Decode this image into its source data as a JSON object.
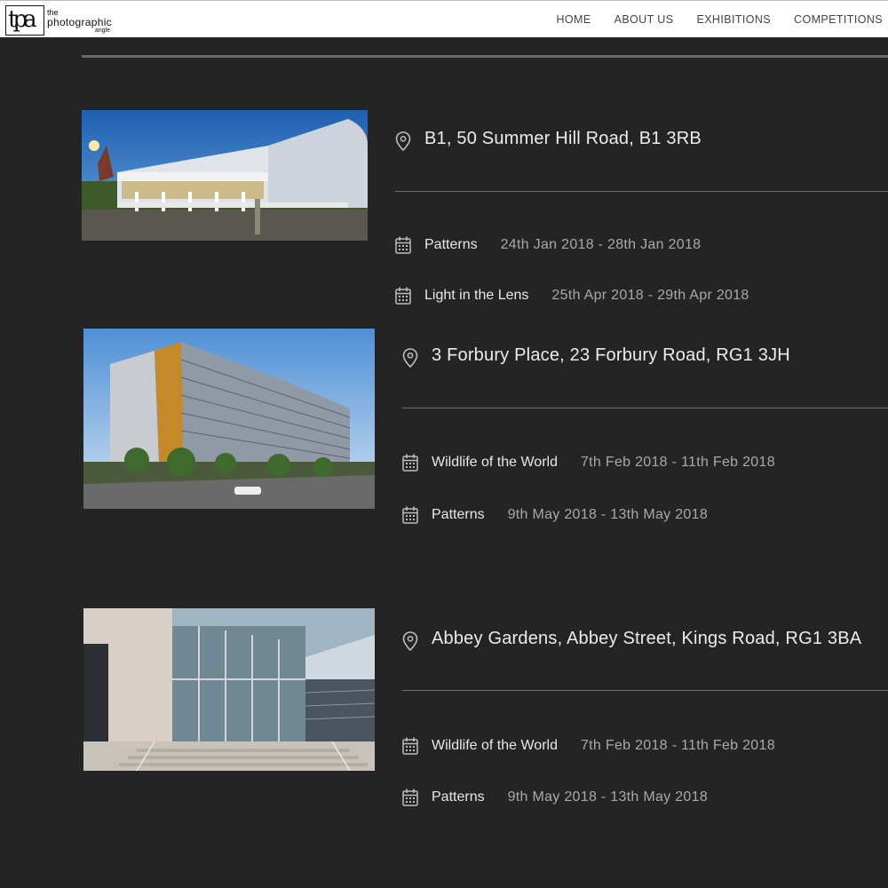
{
  "header": {
    "logo": {
      "line1": "the",
      "line2": "photographic",
      "line3": "angle"
    },
    "nav": [
      "HOME",
      "ABOUT US",
      "EXHIBITIONS",
      "COMPETITIONS"
    ]
  },
  "locations": [
    {
      "address": "B1, 50 Summer Hill Road, B1 3RB",
      "events": [
        {
          "name": "Patterns",
          "dates": "24th Jan 2018 - 28th Jan 2018"
        },
        {
          "name": "Light in the Lens",
          "dates": "25th Apr 2018 - 29th Apr 2018"
        }
      ]
    },
    {
      "address": "3 Forbury Place, 23 Forbury Road, RG1 3JH",
      "events": [
        {
          "name": "Wildlife of the World",
          "dates": "7th Feb 2018 - 11th Feb 2018"
        },
        {
          "name": "Patterns",
          "dates": "9th May 2018 - 13th May 2018"
        }
      ]
    },
    {
      "address": "Abbey Gardens, Abbey Street, Kings Road, RG1 3BA",
      "events": [
        {
          "name": "Wildlife of the World",
          "dates": "7th Feb 2018 - 11th Feb 2018"
        },
        {
          "name": "Patterns",
          "dates": "9th May 2018 - 13th May 2018"
        }
      ]
    }
  ],
  "icons": {
    "location": "map-pin-icon",
    "event": "calendar-icon"
  },
  "colors": {
    "background": "#242424",
    "header": "#ffffff",
    "text": "#ececec",
    "muted": "#a9a9a9"
  }
}
